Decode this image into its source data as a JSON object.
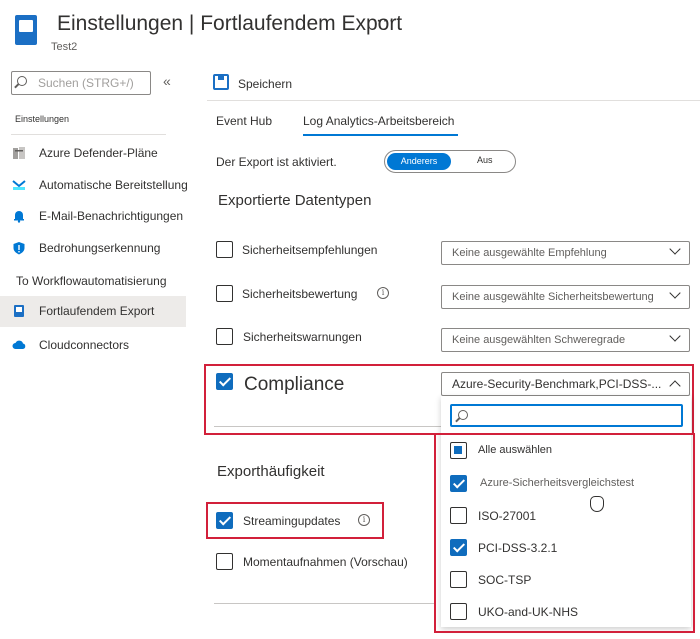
{
  "header": {
    "title": "Einstellungen | Fortlaufendem Export",
    "subtitle": "Test2",
    "more": "···"
  },
  "sidebar": {
    "search_placeholder": "Suchen (STRG+/)",
    "collapse": "«",
    "section_label": "Einstellungen",
    "items": [
      {
        "label": "Azure Defender-Pläne",
        "icon": "defender-plans-icon"
      },
      {
        "label": "Automatische Bereitstellung",
        "icon": "auto-provisioning-icon"
      },
      {
        "label": "E-Mail-Benachrichtigungen",
        "icon": "bell-icon"
      },
      {
        "label": "Bedrohungserkennung",
        "icon": "shield-icon"
      },
      {
        "label": "To Workflowautomatisierung",
        "icon": ""
      },
      {
        "label": "Fortlaufendem Export",
        "icon": "export-icon"
      },
      {
        "label": "Cloudconnectors",
        "icon": "cloud-icon"
      }
    ]
  },
  "toolbar": {
    "save_label": "Speichern"
  },
  "tabs": [
    {
      "label": "Event Hub"
    },
    {
      "label": "Log Analytics-Arbeitsbereich"
    }
  ],
  "export_toggle": {
    "label": "Der Export ist aktiviert.",
    "on_label": "Anderers",
    "off_label": "Aus"
  },
  "data_types": {
    "heading": "Exportierte Datentypen",
    "rows": [
      {
        "label": "Sicherheitsempfehlungen",
        "dropdown": "Keine ausgewählte Empfehlung",
        "checked": false
      },
      {
        "label": "Sicherheitsbewertung",
        "dropdown": "Keine ausgewählte Sicherheitsbewertung",
        "checked": false
      },
      {
        "label": "Sicherheitswarnungen",
        "dropdown": "Keine ausgewählten Schweregrade",
        "checked": false
      },
      {
        "label": "Compliance",
        "dropdown": "Azure-Security-Benchmark,PCI-DSS-...",
        "checked": true
      }
    ]
  },
  "compliance_options": {
    "select_all": "Alle auswählen",
    "items": [
      {
        "label": "Azure-Sicherheitsvergleichstest",
        "checked": true
      },
      {
        "label": "ISO-27001",
        "checked": false
      },
      {
        "label": "PCI-DSS-3.2.1",
        "checked": true
      },
      {
        "label": "SOC-TSP",
        "checked": false
      },
      {
        "label": "UKO-and-UK-NHS",
        "checked": false
      }
    ]
  },
  "frequency": {
    "heading": "Exporthäufigkeit",
    "streaming": "Streamingupdates",
    "snapshots": "Momentaufnahmen (Vorschau)"
  },
  "info_glyph": "i",
  "colors": {
    "accent": "#0078d4",
    "highlight": "#d2203a"
  }
}
